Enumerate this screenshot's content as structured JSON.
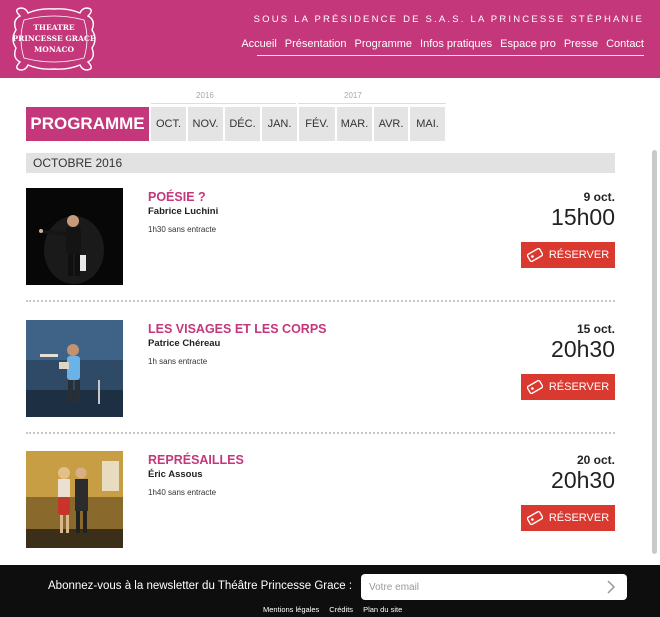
{
  "header": {
    "logo_lines": [
      "THEATRE",
      "PRINCESSE GRACE",
      "MONACO"
    ],
    "patronage": "SOUS LA PRÉSIDENCE DE S.A.S. LA PRINCESSE STÉPHANIE",
    "nav": [
      "Accueil",
      "Présentation",
      "Programme",
      "Infos pratiques",
      "Espace pro",
      "Presse",
      "Contact"
    ]
  },
  "programme": {
    "tab_label": "PROGRAMME",
    "years": [
      "2016",
      "2017"
    ],
    "months": [
      "OCT.",
      "NOV.",
      "DÉC.",
      "JAN.",
      "FÉV.",
      "MAR.",
      "AVR.",
      "MAI."
    ],
    "month_heading": "OCTOBRE 2016"
  },
  "events": [
    {
      "title": "POÉSIE ?",
      "author": "Fabrice Luchini",
      "duration": "1h30 sans entracte",
      "date": "9 oct.",
      "time": "15h00",
      "button": "RÉSERVER"
    },
    {
      "title": "LES VISAGES ET LES CORPS",
      "author": "Patrice Chéreau",
      "duration": "1h sans entracte",
      "date": "15 oct.",
      "time": "20h30",
      "button": "RÉSERVER"
    },
    {
      "title": "REPRÉSAILLES",
      "author": "Éric Assous",
      "duration": "1h40 sans entracte",
      "date": "20 oct.",
      "time": "20h30",
      "button": "RÉSERVER"
    }
  ],
  "footer": {
    "newsletter_label": "Abonnez-vous à la newsletter du Théâtre Princesse Grace :",
    "email_placeholder": "Votre email",
    "links": [
      "Mentions légales",
      "Crédits",
      "Plan du site"
    ]
  },
  "colors": {
    "brand": "#c4377a",
    "reserve": "#d9392f",
    "footer": "#0e0e0e"
  },
  "icons": [
    "ticket-icon",
    "arrow-right-icon"
  ]
}
